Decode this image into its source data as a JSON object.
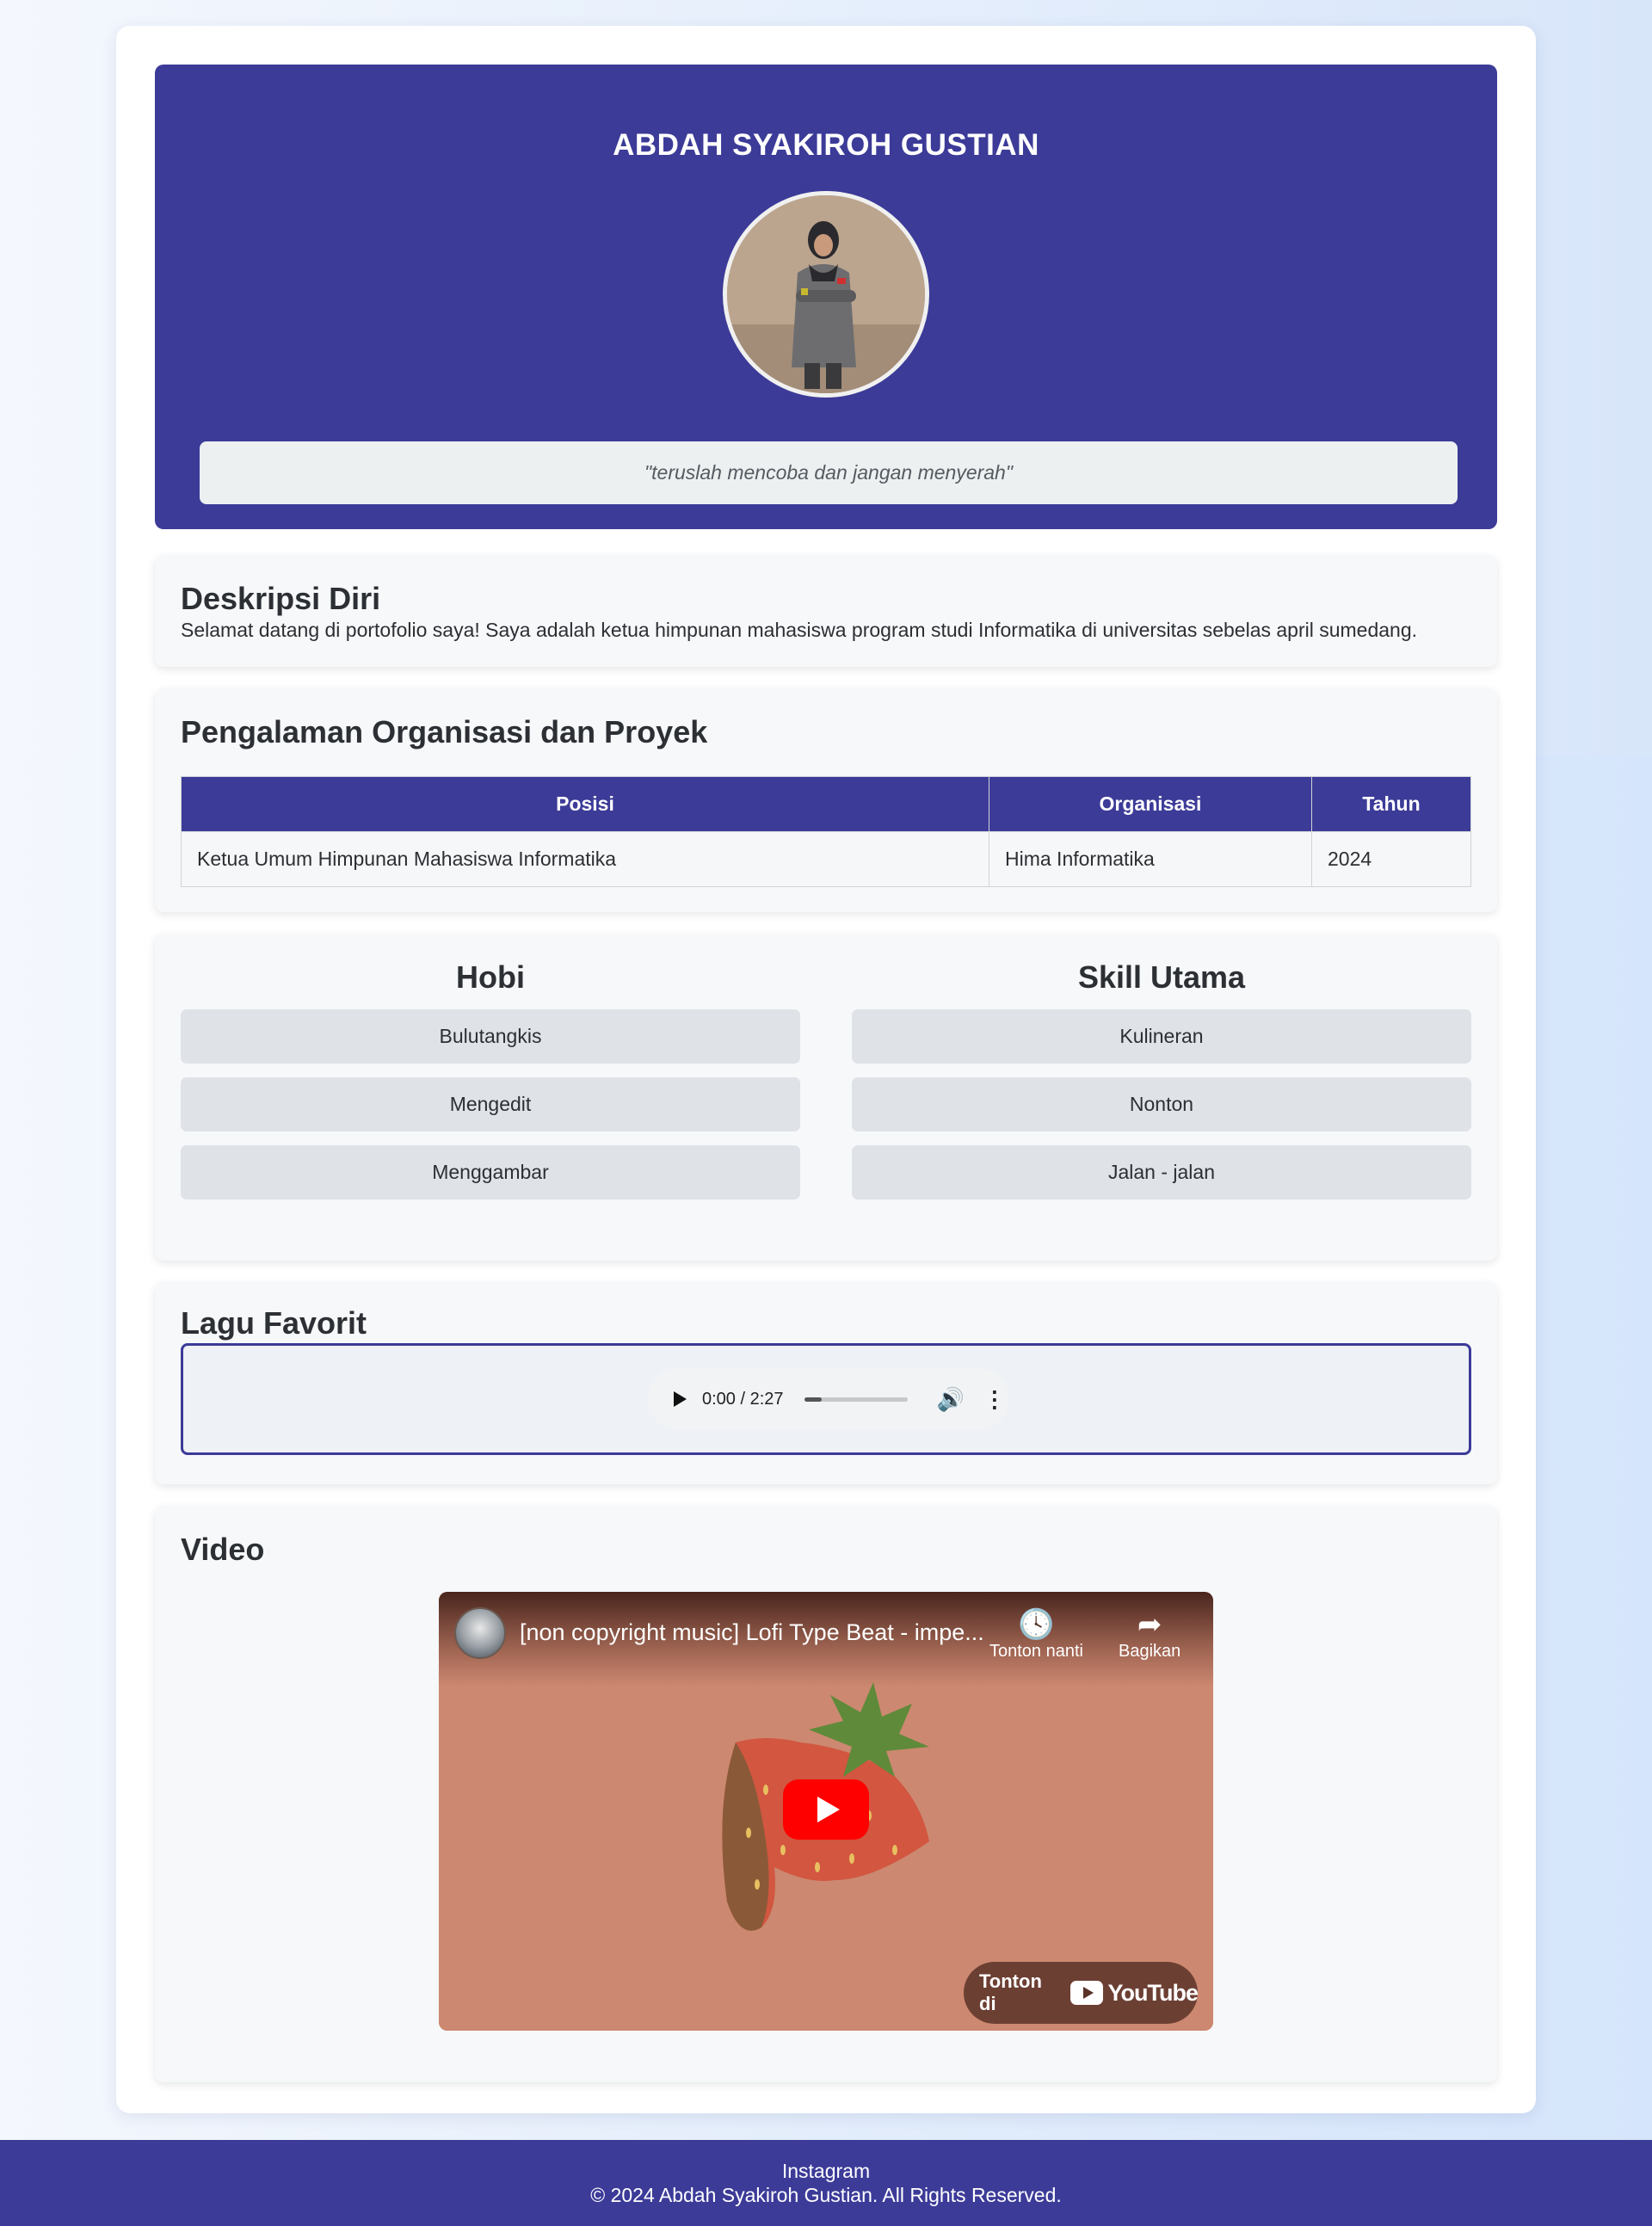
{
  "header": {
    "name": "ABDAH SYAKIROH GUSTIAN",
    "quote": "\"teruslah mencoba dan jangan menyerah\""
  },
  "about": {
    "title": "Deskripsi Diri",
    "text": "Selamat datang di portofolio saya! Saya adalah ketua himpunan mahasiswa program studi Informatika di universitas sebelas april sumedang."
  },
  "experience": {
    "title": "Pengalaman Organisasi dan Proyek",
    "columns": [
      "Posisi",
      "Organisasi",
      "Tahun"
    ],
    "rows": [
      [
        "Ketua Umum Himpunan Mahasiswa Informatika",
        "Hima Informatika",
        "2024"
      ]
    ]
  },
  "hobbies": {
    "title": "Hobi",
    "items": [
      "Bulutangkis",
      "Mengedit",
      "Menggambar"
    ]
  },
  "skills": {
    "title": "Skill Utama",
    "items": [
      "Kulineran",
      "Nonton",
      "Jalan - jalan"
    ]
  },
  "song": {
    "title": "Lagu Favorit",
    "time": "0:00 / 2:27",
    "progress_fraction": 0.17
  },
  "video": {
    "title": "Video",
    "video_title": "[non copyright music] Lofi Type Beat - impe...",
    "watch_later": "Tonton nanti",
    "share": "Bagikan",
    "watch_on": "Tonton di",
    "brand": "YouTube"
  },
  "footer": {
    "link": "Instagram",
    "copyright": "© 2024 Abdah Syakiroh Gustian. All Rights Reserved."
  },
  "colors": {
    "primary": "#3c3b98",
    "youtube_red": "#ff0000"
  }
}
